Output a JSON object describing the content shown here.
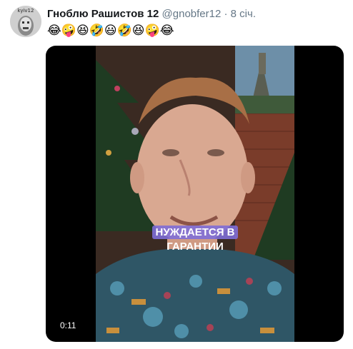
{
  "tweet": {
    "avatar_label": "kyiv12",
    "display_name": "Гноблю Рашистов 12",
    "handle": "@gnobfer12",
    "separator": "·",
    "timestamp": "8 січ.",
    "text": "😂🤪😆🤣😃🤣😆🤪😂"
  },
  "video": {
    "caption_line1": "НУЖДАЕТСЯ В",
    "caption_line2": "ГАРАНТИИ",
    "duration": "0:11"
  }
}
